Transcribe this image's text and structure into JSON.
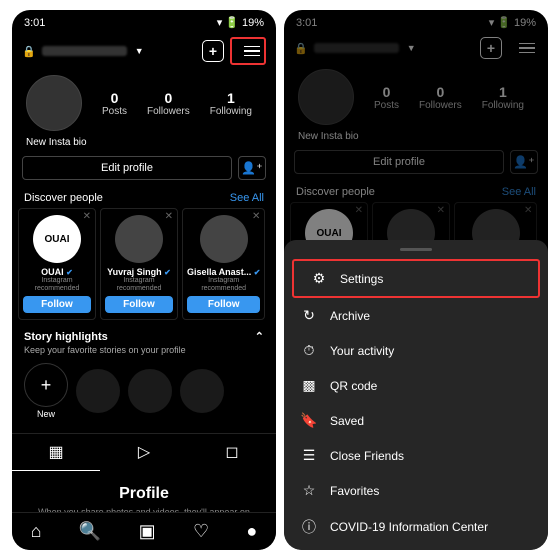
{
  "status": {
    "time": "3:01",
    "battery": "19%"
  },
  "stats": {
    "posts": {
      "n": "0",
      "l": "Posts"
    },
    "followers": {
      "n": "0",
      "l": "Followers"
    },
    "following": {
      "n": "1",
      "l": "Following"
    }
  },
  "bio": "New Insta bio",
  "edit": "Edit profile",
  "discover": {
    "title": "Discover people",
    "seeall": "See All"
  },
  "cards": [
    {
      "name": "OUAI",
      "sub1": "Instagram",
      "sub2": "recommended",
      "btn": "Follow",
      "logo": "OUAI"
    },
    {
      "name": "Yuvraj Singh",
      "sub1": "Instagram",
      "sub2": "recommended",
      "btn": "Follow"
    },
    {
      "name": "Gisella Anast...",
      "sub1": "Instagram",
      "sub2": "recommended",
      "btn": "Follow"
    }
  ],
  "story": {
    "title": "Story highlights",
    "sub": "Keep your favorite stories on your profile",
    "new": "New"
  },
  "empty": {
    "title": "Profile",
    "sub": "When you share photos and videos, they'll appear on your profile."
  },
  "menu": {
    "settings": "Settings",
    "archive": "Archive",
    "activity": "Your activity",
    "qr": "QR code",
    "saved": "Saved",
    "close": "Close Friends",
    "fav": "Favorites",
    "covid": "COVID-19 Information Center"
  }
}
